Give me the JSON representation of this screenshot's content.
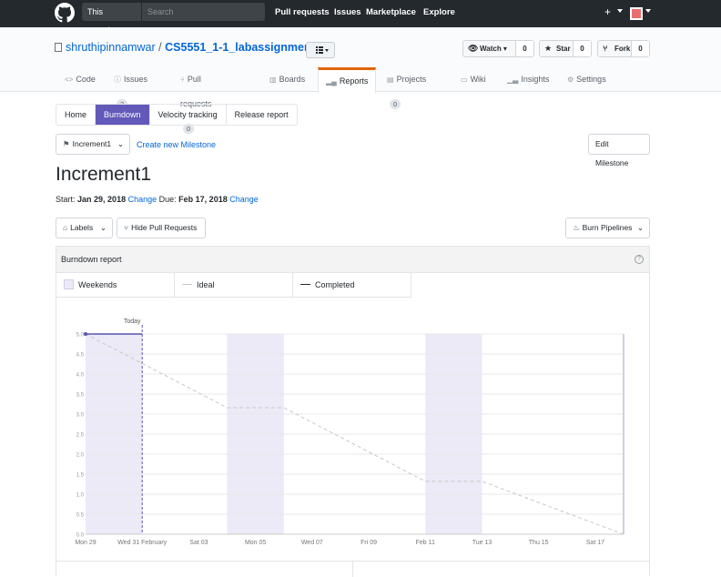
{
  "header": {
    "search_scope": "This repository",
    "search_placeholder": "Search",
    "nav": [
      "Pull requests",
      "Issues",
      "Marketplace",
      "Explore"
    ],
    "plus": "+"
  },
  "repo": {
    "owner": "shruthipinnamwar",
    "separator": "/",
    "name": "CS5551_1-1_labassignments",
    "watch_label": "Watch",
    "watch_count": "0",
    "star_label": "Star",
    "star_count": "0",
    "fork_label": "Fork",
    "fork_count": "0"
  },
  "tabs": [
    {
      "label": "Code",
      "icon": "code-icon"
    },
    {
      "label": "Issues",
      "count": "3",
      "icon": "issue-icon"
    },
    {
      "label": "Pull requests",
      "count": "0",
      "icon": "pull-request-icon"
    },
    {
      "label": "Boards",
      "icon": "boards-icon"
    },
    {
      "label": "Reports",
      "icon": "reports-icon",
      "selected": true
    },
    {
      "label": "Projects",
      "count": "0",
      "icon": "project-icon"
    },
    {
      "label": "Wiki",
      "icon": "book-icon"
    },
    {
      "label": "Insights",
      "icon": "graph-icon"
    },
    {
      "label": "Settings",
      "icon": "gear-icon"
    }
  ],
  "subtabs": [
    "Home",
    "Burndown",
    "Velocity tracking",
    "Release report"
  ],
  "milestone": {
    "selector": "Increment1",
    "create_link": "Create new Milestone",
    "edit_button": "Edit Milestone",
    "title": "Increment1",
    "start_label": "Start:",
    "start_date": "Jan 29, 2018",
    "change1": "Change",
    "due_label": "Due:",
    "due_date": "Feb 17, 2018",
    "change2": "Change"
  },
  "filters": {
    "labels": "Labels",
    "hide_prs": "Hide Pull Requests",
    "burn_pipelines": "Burn Pipelines"
  },
  "report": {
    "title": "Burndown report",
    "help": "?",
    "legend": [
      "Weekends",
      "Ideal",
      "Completed"
    ]
  },
  "colors": {
    "accent": "#6259b9",
    "weekend": "#ebeaf6",
    "ideal": "#c8c8c8",
    "completed": "#5a52b0"
  },
  "chart_data": {
    "type": "line",
    "x": [
      "Mon 29",
      "Wed 31 February",
      "Sat 03",
      "Mon 05",
      "Wed 07",
      "Fri 09",
      "Feb 11",
      "Tue 13",
      "Thu 15",
      "Sat 17"
    ],
    "ylim": [
      0,
      5.0
    ],
    "yticks": [
      "0.0",
      "0.5",
      "1.0",
      "1.5",
      "2.0",
      "2.5",
      "3.0",
      "3.5",
      "4.0",
      "4.5",
      "5.0"
    ],
    "today_label": "Today",
    "series": [
      {
        "name": "Ideal",
        "points": [
          [
            "Jan 29",
            5.0
          ],
          [
            "Feb 3",
            3.16
          ],
          [
            "Feb 5",
            3.16
          ],
          [
            "Feb 10",
            1.32
          ],
          [
            "Feb 12",
            1.32
          ],
          [
            "Feb 17",
            0.0
          ]
        ]
      },
      {
        "name": "Completed",
        "points": [
          [
            "Jan 29",
            5.0
          ],
          [
            "Jan 31",
            5.0
          ]
        ]
      }
    ],
    "weekends": [
      [
        "Jan 29",
        "Jan 31"
      ],
      [
        "Feb 3",
        "Feb 5"
      ],
      [
        "Feb 10",
        "Feb 12"
      ]
    ]
  }
}
